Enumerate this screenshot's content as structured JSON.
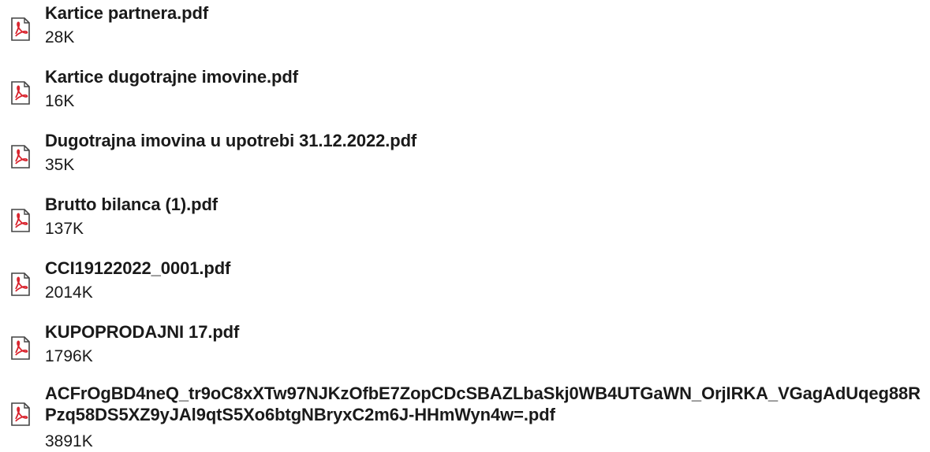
{
  "attachments": [
    {
      "name": "Kartice partnera.pdf",
      "size": "28K",
      "icon": "pdf-file-icon"
    },
    {
      "name": "Kartice dugotrajne imovine.pdf",
      "size": "16K",
      "icon": "pdf-file-icon"
    },
    {
      "name": "Dugotrajna imovina u upotrebi 31.12.2022.pdf",
      "size": "35K",
      "icon": "pdf-file-icon"
    },
    {
      "name": "Brutto bilanca (1).pdf",
      "size": "137K",
      "icon": "pdf-file-icon"
    },
    {
      "name": "CCI19122022_0001.pdf",
      "size": "2014K",
      "icon": "pdf-file-icon"
    },
    {
      "name": "KUPOPRODAJNI 17.pdf",
      "size": "1796K",
      "icon": "pdf-file-icon"
    },
    {
      "name": "ACFrOgBD4neQ_tr9oC8xXTw97NJKzOfbE7ZopCDcSBAZLbaSkj0WB4UTGaWN_OrjIRKA_VGagAdUqeg88RPzq58DS5XZ9yJAl9qtS5Xo6btgNBryxC2m6J-HHmWyn4w=.pdf",
      "size": "3891K",
      "icon": "pdf-file-icon"
    }
  ],
  "colors": {
    "text": "#1a1a1a",
    "icon_red": "#d9232d",
    "background": "#ffffff"
  }
}
